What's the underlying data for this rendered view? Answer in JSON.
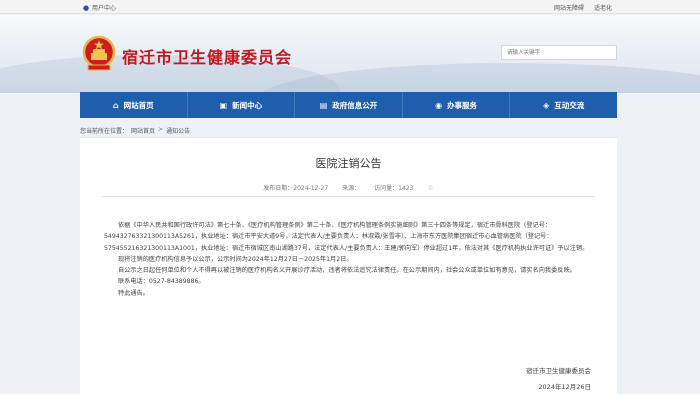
{
  "topbar": {
    "user_center": "用户中心",
    "links": [
      "网站无障碍",
      "适老化"
    ]
  },
  "header": {
    "site_title": "宿迁市卫生健康委员会",
    "search_placeholder": "请输入关键字"
  },
  "nav": {
    "items": [
      {
        "icon": "home-icon",
        "label": "网站首页"
      },
      {
        "icon": "news-icon",
        "label": "新闻中心"
      },
      {
        "icon": "info-icon",
        "label": "政府信息公开"
      },
      {
        "icon": "service-icon",
        "label": "办事服务"
      },
      {
        "icon": "interaction-icon",
        "label": "互动交流"
      }
    ]
  },
  "breadcrumb": {
    "prefix": "您当前所在位置：",
    "home": "网站首页",
    "sep": ">",
    "current": "通知公告"
  },
  "article": {
    "title": "医院注销公告",
    "date_label": "发布日期：2024-12-27",
    "source_label": "来源：",
    "views_label": "访问量：1423",
    "paragraphs": [
      "依据《中华人民共和国行政许可法》第七十条、《医疗机构管理条例》第二十条、《医疗机构管理条例实施细则》第三十四条等规定，宿迁市骨科医院（登记号：549432763321300113A5261，执业地址：宿迁市平安大道9号，法定代表人/主要负责人：林淑霞/张雪非）、上海市东方医院集团宿迁市心血管病医院（登记号：575455216321300113A1001，执业地址：宿迁市宿城区南山湖路37号，法定代表人/主要负责人：王建/郭向军）停业超过1年，依法对其《医疗机构执业许可证》予以注销。",
      "现将注销的医疗机构信息予以公示，公示时间为2024年12月27日－2025年1月2日。",
      "自公示之日起任何单位和个人不得再以被注销的医疗机构名义开展诊疗活动，违者将依法追究法律责任。在公示期间内，社会公众或单位如有意见，请实名向我委反映。",
      "联系电话：0527-84389886。",
      "特此通告。"
    ],
    "signature": "宿迁市卫生健康委员会",
    "sign_date": "2024年12月26日"
  }
}
